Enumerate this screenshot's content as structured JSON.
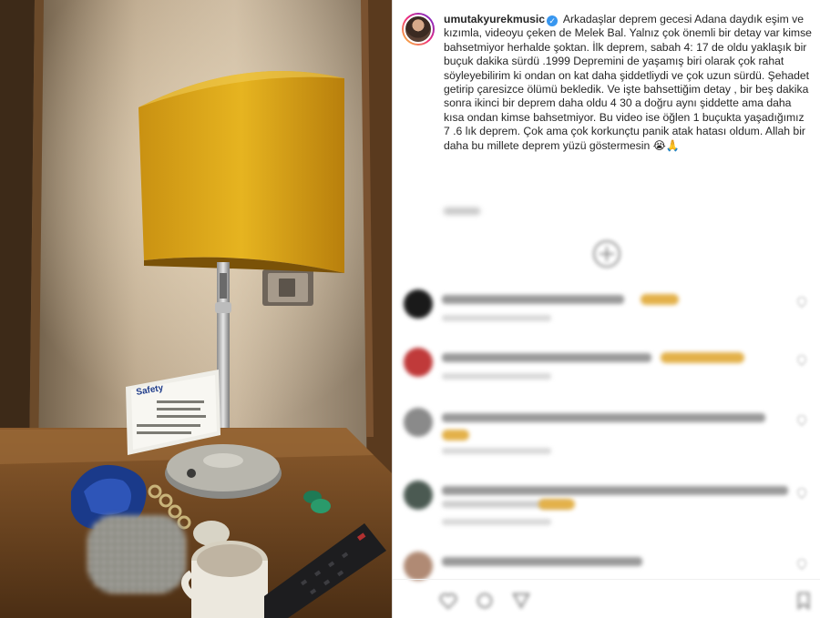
{
  "post": {
    "username": "umutakyurekmusic",
    "verified_badge": "✓",
    "caption": "Arkadaşlar deprem gecesi Adana daydık eşim ve kızımla, videoyu çeken de Melek Bal. Yalnız çok önemli bir detay var kimse bahsetmiyor herhalde şoktan. İlk deprem, sabah 4: 17 de oldu yaklaşık bir buçuk dakika sürdü .1999 Depremini de yaşamış biri olarak çok rahat söyleyebilirim ki ondan on kat daha şiddetliydi ve çok uzun sürdü. Şehadet getirip çaresizce ölümü bekledik. Ve işte bahsettiğim detay , bir beş dakika sonra ikinci bir deprem daha oldu 4 30 a doğru aynı şiddette ama daha kısa ondan kimse bahsetmiyor. Bu video ise öğlen 1 buçukta yaşadığımız 7 .6 lık deprem. Çok ama çok korkunçtu panik atak hatası oldum. Allah bir daha bu millete deprem yüzü göstermesin 😭🙏"
  },
  "media": {
    "card_title": "Safety"
  },
  "icons": {
    "verified": "verified-badge-icon",
    "load_more": "plus-circle-icon",
    "like": "heart-icon",
    "comment": "comment-icon",
    "share": "share-icon",
    "save": "bookmark-icon"
  },
  "colors": {
    "lamp_shade": "#d9a61c",
    "verified": "#3897f0"
  }
}
